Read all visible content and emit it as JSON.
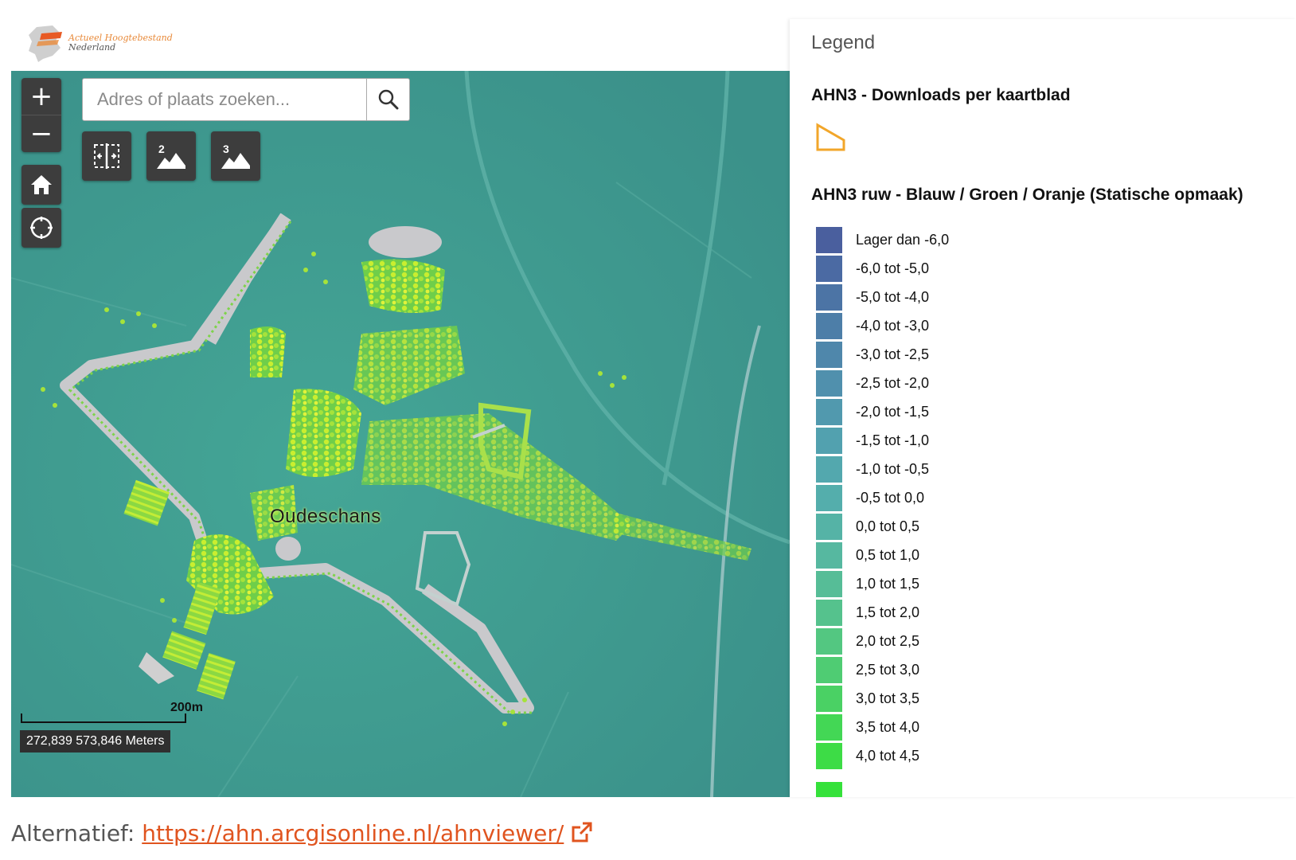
{
  "header": {
    "logo_line1": "Actueel Hoogtebestand",
    "logo_line2": "Nederland"
  },
  "map": {
    "search": {
      "placeholder": "Adres of plaats zoeken..."
    },
    "controls": {
      "zoom_in": "+",
      "zoom_out": "−",
      "home_icon": "home-icon",
      "locate_icon": "locate-icon"
    },
    "tools": [
      {
        "icon": "swipe-compare-icon"
      },
      {
        "icon": "terrain-2d-icon",
        "label": "2"
      },
      {
        "icon": "terrain-3d-icon",
        "label": "3"
      }
    ],
    "place_label": "Oudeschans",
    "scale_label": "200m",
    "coordinates": "272,839 573,846 Meters",
    "colors": {
      "background": "#3e9a8e",
      "dike": "#c9c9cc",
      "vegetation": "#a7e62e",
      "buildings": "#d7ec3a"
    }
  },
  "legend": {
    "title": "Legend",
    "layer1_title": "AHN3 - Downloads per kaartblad",
    "layer1_symbol_color": "#f2a62a",
    "layer2_title": "AHN3 ruw - Blauw / Groen / Oranje (Statische opmaak)",
    "items": [
      {
        "label": "Lager dan -6,0",
        "color": "#4a5f9e"
      },
      {
        "label": "-6,0 tot -5,0",
        "color": "#4b6aa3"
      },
      {
        "label": "-5,0 tot -4,0",
        "color": "#4c74a5"
      },
      {
        "label": "-4,0 tot -3,0",
        "color": "#4d7ea8"
      },
      {
        "label": "-3,0 tot -2,5",
        "color": "#4f87ab"
      },
      {
        "label": "-2,5 tot -2,0",
        "color": "#5090ad"
      },
      {
        "label": "-2,0 tot -1,5",
        "color": "#5199ae"
      },
      {
        "label": "-1,5 tot -1,0",
        "color": "#52a1af"
      },
      {
        "label": "-1,0 tot -0,5",
        "color": "#53a8ae"
      },
      {
        "label": "-0,5 tot 0,0",
        "color": "#54aeac"
      },
      {
        "label": "0,0 tot 0,5",
        "color": "#55b3a6"
      },
      {
        "label": "0,5 tot 1,0",
        "color": "#56b8a0"
      },
      {
        "label": "1,0 tot 1,5",
        "color": "#56bd97"
      },
      {
        "label": "1,5 tot 2,0",
        "color": "#55c28d"
      },
      {
        "label": "2,0 tot 2,5",
        "color": "#53c781"
      },
      {
        "label": "2,5 tot 3,0",
        "color": "#4fcc73"
      },
      {
        "label": "3,0 tot 3,5",
        "color": "#4ad164"
      },
      {
        "label": "3,5 tot 4,0",
        "color": "#43d755"
      },
      {
        "label": "4,0 tot 4,5",
        "color": "#3ddc46"
      }
    ]
  },
  "footer": {
    "label": "Alternatief:",
    "link_text": "https://ahn.arcgisonline.nl/ahnviewer/",
    "link_color": "#e0541f"
  }
}
